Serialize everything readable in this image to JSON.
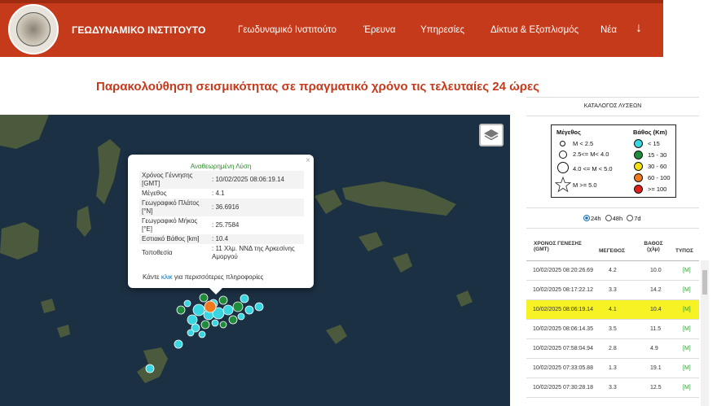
{
  "header": {
    "brand": "ΓΕΩΔΥΝΑΜΙΚΟ ΙΝΣΤΙΤΟΥΤΟ",
    "nav": [
      {
        "label": "Γεωδυναμικό Ινστιτούτο"
      },
      {
        "label": "Έρευνα"
      },
      {
        "label": "Υπηρεσίες"
      },
      {
        "label": "Δίκτυα & Εξοπλισμός"
      },
      {
        "label": "Νέα"
      }
    ],
    "more_icon": "arrow-down-icon"
  },
  "page_title": "Παρακολούθηση σεισμικότητας σε πραγματικό χρόνο τις τελευταίες 24 ώρες",
  "popup": {
    "title": "Αναθεωρημένη Λύση",
    "close": "×",
    "rows": [
      {
        "label": "Χρόνος Γέννησης [GMT]",
        "value": ": 10/02/2025 08:06:19.14"
      },
      {
        "label": "Μέγεθος",
        "value": ": 4.1"
      },
      {
        "label": "Γεωγραφικό Πλάτος [°N]",
        "value": ": 36.6916"
      },
      {
        "label": "Γεωγραφικό Μήκος [°E]",
        "value": ": 25.7584"
      },
      {
        "label": "Εστιακό Βάθος [km]",
        "value": ": 10.4"
      },
      {
        "label": "Τοποθεσία",
        "value": ": 11 Χλμ. ΝΝΔ της Αρκεσίνης Αμοργού"
      }
    ],
    "more_prefix": "Κάντε ",
    "more_link": "κλικ",
    "more_suffix": " για περισσότερες πληροφορίες"
  },
  "legend": {
    "catalog_title": "ΚΑΤΑΛΟΓΟΣ ΛΥΣΕΩΝ",
    "magnitude_title": "Μέγεθος",
    "depth_title": "Βάθος (Km)",
    "magnitudes": [
      "M < 2.5",
      "2.5<= M< 4.0",
      "4.0 <= M < 5.0",
      "M >= 5.0"
    ],
    "depths": [
      {
        "label": "< 15",
        "color": "#38d6e0"
      },
      {
        "label": "15 - 30",
        "color": "#1f8c3b"
      },
      {
        "label": "30 - 60",
        "color": "#f1e20f"
      },
      {
        "label": "60 - 100",
        "color": "#f07a1d"
      },
      {
        "label": ">= 100",
        "color": "#e01e1e"
      }
    ]
  },
  "period": {
    "options": [
      "24h",
      "48h",
      "7d"
    ],
    "selected": "24h"
  },
  "table": {
    "headers": {
      "time": "ΧΡΟΝΟΣ ΓΕΝΕΣΗΣ (GMT)",
      "mag": "ΜΕΓΕΘΟΣ",
      "depth": "ΒΑΘΟΣ (χλμ)",
      "type": "ΤΥΠΟΣ"
    },
    "rows": [
      {
        "time": "10/02/2025 08:20:26.69",
        "mag": "4.2",
        "depth": "10.0",
        "type": "[M]",
        "highlight": false
      },
      {
        "time": "10/02/2025 08:17:22.12",
        "mag": "3.3",
        "depth": "14.2",
        "type": "[M]",
        "highlight": false
      },
      {
        "time": "10/02/2025 08:06:19.14",
        "mag": "4.1",
        "depth": "10.4",
        "type": "[M]",
        "highlight": true
      },
      {
        "time": "10/02/2025 08:06:14.35",
        "mag": "3.5",
        "depth": "11.5",
        "type": "[M]",
        "highlight": false
      },
      {
        "time": "10/02/2025 07:58:04.94",
        "mag": "2.8",
        "depth": "4.9",
        "type": "[M]",
        "highlight": false
      },
      {
        "time": "10/02/2025 07:33:05.88",
        "mag": "1.3",
        "depth": "19.1",
        "type": "[M]",
        "highlight": false
      },
      {
        "time": "10/02/2025 07:30:28.18",
        "mag": "3.3",
        "depth": "12.5",
        "type": "[M]",
        "highlight": false
      }
    ]
  },
  "colors": {
    "header_bg": "#c53a1b",
    "highlight": "#f7f223",
    "shallow": "#38d6e0",
    "mid": "#1f8c3b"
  }
}
